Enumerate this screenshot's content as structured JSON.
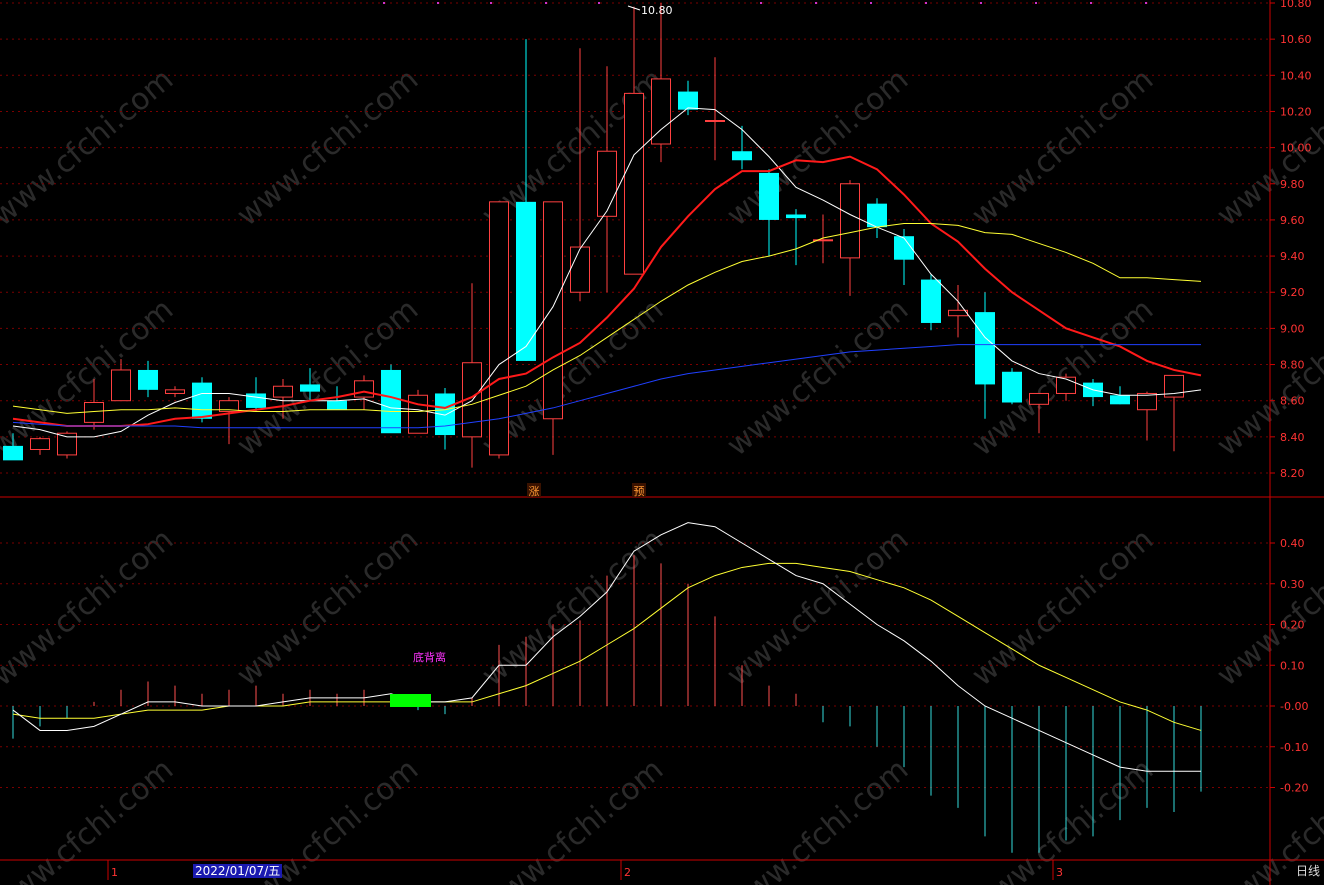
{
  "chart_data": [
    {
      "type": "candlestick",
      "y_axis_ticks": [
        "10.80",
        "10.60",
        "10.40",
        "10.20",
        "10.00",
        "9.80",
        "9.60",
        "9.40",
        "9.20",
        "9.00",
        "8.80",
        "8.60",
        "8.40",
        "8.20"
      ],
      "ylim": [
        8.1,
        10.82
      ],
      "high_label": "10.80",
      "signal_labels": [
        "涨",
        "预"
      ],
      "candles": [
        {
          "o": 8.35,
          "h": 8.42,
          "l": 8.3,
          "c": 8.27
        },
        {
          "o": 8.33,
          "h": 8.4,
          "l": 8.3,
          "c": 8.39
        },
        {
          "o": 8.3,
          "h": 8.43,
          "l": 8.28,
          "c": 8.42
        },
        {
          "o": 8.48,
          "h": 8.72,
          "l": 8.44,
          "c": 8.59
        },
        {
          "o": 8.6,
          "h": 8.83,
          "l": 8.6,
          "c": 8.77
        },
        {
          "o": 8.77,
          "h": 8.82,
          "l": 8.62,
          "c": 8.66
        },
        {
          "o": 8.64,
          "h": 8.68,
          "l": 8.62,
          "c": 8.66
        },
        {
          "o": 8.7,
          "h": 8.73,
          "l": 8.48,
          "c": 8.5
        },
        {
          "o": 8.54,
          "h": 8.62,
          "l": 8.36,
          "c": 8.6
        },
        {
          "o": 8.64,
          "h": 8.73,
          "l": 8.54,
          "c": 8.56
        },
        {
          "o": 8.62,
          "h": 8.72,
          "l": 8.5,
          "c": 8.68
        },
        {
          "o": 8.69,
          "h": 8.78,
          "l": 8.6,
          "c": 8.65
        },
        {
          "o": 8.6,
          "h": 8.68,
          "l": 8.55,
          "c": 8.55
        },
        {
          "o": 8.62,
          "h": 8.74,
          "l": 8.55,
          "c": 8.71
        },
        {
          "o": 8.77,
          "h": 8.8,
          "l": 8.43,
          "c": 8.42
        },
        {
          "o": 8.42,
          "h": 8.66,
          "l": 8.42,
          "c": 8.63
        },
        {
          "o": 8.64,
          "h": 8.67,
          "l": 8.33,
          "c": 8.41
        },
        {
          "o": 8.4,
          "h": 9.25,
          "l": 8.23,
          "c": 8.81
        },
        {
          "o": 8.3,
          "h": 9.7,
          "l": 8.28,
          "c": 9.7
        },
        {
          "o": 9.7,
          "h": 10.6,
          "l": 8.82,
          "c": 8.82
        },
        {
          "o": 8.5,
          "h": 9.7,
          "l": 8.3,
          "c": 9.7
        },
        {
          "o": 9.2,
          "h": 10.55,
          "l": 9.15,
          "c": 9.45
        },
        {
          "o": 9.62,
          "h": 10.45,
          "l": 9.2,
          "c": 9.98
        },
        {
          "o": 9.3,
          "h": 10.78,
          "l": 9.3,
          "c": 10.3
        },
        {
          "o": 10.02,
          "h": 10.8,
          "l": 9.92,
          "c": 10.38
        },
        {
          "o": 10.31,
          "h": 10.37,
          "l": 10.18,
          "c": 10.21
        },
        {
          "o": 10.15,
          "h": 10.5,
          "l": 9.93,
          "c": 10.15
        },
        {
          "o": 9.98,
          "h": 10.12,
          "l": 9.88,
          "c": 9.93
        },
        {
          "o": 9.86,
          "h": 9.88,
          "l": 9.4,
          "c": 9.6
        },
        {
          "o": 9.63,
          "h": 9.66,
          "l": 9.35,
          "c": 9.61
        },
        {
          "o": 9.49,
          "h": 9.63,
          "l": 9.36,
          "c": 9.49
        },
        {
          "o": 9.39,
          "h": 9.82,
          "l": 9.18,
          "c": 9.8
        },
        {
          "o": 9.69,
          "h": 9.72,
          "l": 9.5,
          "c": 9.56
        },
        {
          "o": 9.51,
          "h": 9.55,
          "l": 9.24,
          "c": 9.38
        },
        {
          "o": 9.27,
          "h": 9.3,
          "l": 8.99,
          "c": 9.03
        },
        {
          "o": 9.07,
          "h": 9.24,
          "l": 8.95,
          "c": 9.1
        },
        {
          "o": 9.09,
          "h": 9.2,
          "l": 8.5,
          "c": 8.69
        },
        {
          "o": 8.76,
          "h": 8.78,
          "l": 8.58,
          "c": 8.59
        },
        {
          "o": 8.58,
          "h": 8.64,
          "l": 8.42,
          "c": 8.64
        },
        {
          "o": 8.64,
          "h": 8.75,
          "l": 8.6,
          "c": 8.73
        },
        {
          "o": 8.7,
          "h": 8.72,
          "l": 8.57,
          "c": 8.62
        },
        {
          "o": 8.63,
          "h": 8.68,
          "l": 8.58,
          "c": 8.58
        },
        {
          "o": 8.55,
          "h": 8.65,
          "l": 8.38,
          "c": 8.64
        },
        {
          "o": 8.62,
          "h": 8.74,
          "l": 8.32,
          "c": 8.74
        }
      ],
      "moving_averages": [
        {
          "color": "#ffffff",
          "values": [
            8.46,
            8.44,
            8.4,
            8.4,
            8.43,
            8.52,
            8.59,
            8.64,
            8.64,
            8.62,
            8.6,
            8.6,
            8.6,
            8.61,
            8.56,
            8.55,
            8.52,
            8.6,
            8.8,
            8.9,
            9.12,
            9.44,
            9.65,
            9.96,
            10.1,
            10.22,
            10.21,
            10.1,
            9.95,
            9.78,
            9.71,
            9.63,
            9.56,
            9.5,
            9.3,
            9.15,
            8.95,
            8.82,
            8.75,
            8.72,
            8.66,
            8.63,
            8.63,
            8.64,
            8.66
          ]
        },
        {
          "color": "#ff1a1a",
          "values": [
            8.5,
            8.48,
            8.46,
            8.46,
            8.46,
            8.47,
            8.5,
            8.51,
            8.53,
            8.55,
            8.57,
            8.6,
            8.62,
            8.65,
            8.62,
            8.58,
            8.56,
            8.62,
            8.72,
            8.75,
            8.84,
            8.92,
            9.06,
            9.22,
            9.45,
            9.62,
            9.77,
            9.87,
            9.87,
            9.93,
            9.92,
            9.95,
            9.88,
            9.74,
            9.58,
            9.48,
            9.33,
            9.2,
            9.1,
            9.0,
            8.95,
            8.9,
            8.82,
            8.77,
            8.74
          ]
        },
        {
          "color": "#ffff33",
          "values": [
            8.57,
            8.55,
            8.53,
            8.54,
            8.55,
            8.55,
            8.56,
            8.55,
            8.55,
            8.54,
            8.54,
            8.55,
            8.55,
            8.55,
            8.54,
            8.54,
            8.55,
            8.58,
            8.63,
            8.68,
            8.77,
            8.85,
            8.95,
            9.05,
            9.15,
            9.24,
            9.31,
            9.37,
            9.4,
            9.44,
            9.5,
            9.53,
            9.56,
            9.58,
            9.58,
            9.57,
            9.53,
            9.52,
            9.47,
            9.42,
            9.36,
            9.28,
            9.28,
            9.27,
            9.26
          ]
        },
        {
          "color": "#2040ff",
          "values": [
            8.48,
            8.47,
            8.46,
            8.46,
            8.46,
            8.46,
            8.46,
            8.45,
            8.45,
            8.45,
            8.45,
            8.45,
            8.45,
            8.45,
            8.45,
            8.45,
            8.46,
            8.48,
            8.5,
            8.53,
            8.56,
            8.6,
            8.64,
            8.68,
            8.72,
            8.75,
            8.77,
            8.79,
            8.81,
            8.83,
            8.85,
            8.87,
            8.88,
            8.89,
            8.9,
            8.91,
            8.91,
            8.91,
            8.91,
            8.91,
            8.91,
            8.91,
            8.91,
            8.91,
            8.91
          ]
        }
      ]
    },
    {
      "type": "macd",
      "y_axis_ticks": [
        "0.40",
        "0.30",
        "0.20",
        "0.10",
        "-0.00",
        "-0.10",
        "-0.20"
      ],
      "ylim": [
        -0.33,
        0.5
      ],
      "annotation": "底背离",
      "histogram": [
        -0.08,
        -0.05,
        -0.03,
        0.01,
        0.04,
        0.06,
        0.05,
        0.03,
        0.04,
        0.05,
        0.03,
        0.04,
        0.03,
        0.04,
        0.0,
        -0.01,
        -0.02,
        0.02,
        0.15,
        0.17,
        0.2,
        0.21,
        0.32,
        0.37,
        0.35,
        0.3,
        0.22,
        0.1,
        0.05,
        0.03,
        -0.04,
        -0.05,
        -0.1,
        -0.15,
        -0.22,
        -0.25,
        -0.32,
        -0.36,
        -0.36,
        -0.33,
        -0.32,
        -0.28,
        -0.25,
        -0.26,
        -0.21
      ],
      "dif": [
        -0.01,
        -0.06,
        -0.06,
        -0.05,
        -0.02,
        0.01,
        0.01,
        0.0,
        0.0,
        0.0,
        0.01,
        0.02,
        0.02,
        0.02,
        0.03,
        0.01,
        0.01,
        0.02,
        0.1,
        0.1,
        0.17,
        0.22,
        0.28,
        0.38,
        0.42,
        0.45,
        0.44,
        0.4,
        0.36,
        0.32,
        0.3,
        0.25,
        0.2,
        0.16,
        0.11,
        0.05,
        0.0,
        -0.03,
        -0.06,
        -0.09,
        -0.12,
        -0.15,
        -0.16,
        -0.16,
        -0.16
      ],
      "dea": [
        -0.02,
        -0.03,
        -0.03,
        -0.03,
        -0.02,
        -0.01,
        -0.01,
        -0.01,
        0.0,
        0.0,
        0.0,
        0.01,
        0.01,
        0.01,
        0.01,
        0.01,
        0.01,
        0.01,
        0.03,
        0.05,
        0.08,
        0.11,
        0.15,
        0.19,
        0.24,
        0.29,
        0.32,
        0.34,
        0.35,
        0.35,
        0.34,
        0.33,
        0.31,
        0.29,
        0.26,
        0.22,
        0.18,
        0.14,
        0.1,
        0.07,
        0.04,
        0.01,
        -0.01,
        -0.04,
        -0.06
      ]
    }
  ],
  "x_axis": {
    "month_labels": [
      {
        "index": 4,
        "text": "1"
      },
      {
        "index": 23,
        "text": "2"
      },
      {
        "index": 39,
        "text": "3"
      }
    ],
    "crosshair_date": "2022/01/07/五",
    "period_label": "日线"
  },
  "watermark": "www.cfchi.com",
  "colors": {
    "up": "#ff4040",
    "down": "#00ffff",
    "axis": "#cc0000",
    "grid": "#7a0000",
    "macd_box": "#00ff00",
    "annotation": "#ff33ff"
  }
}
